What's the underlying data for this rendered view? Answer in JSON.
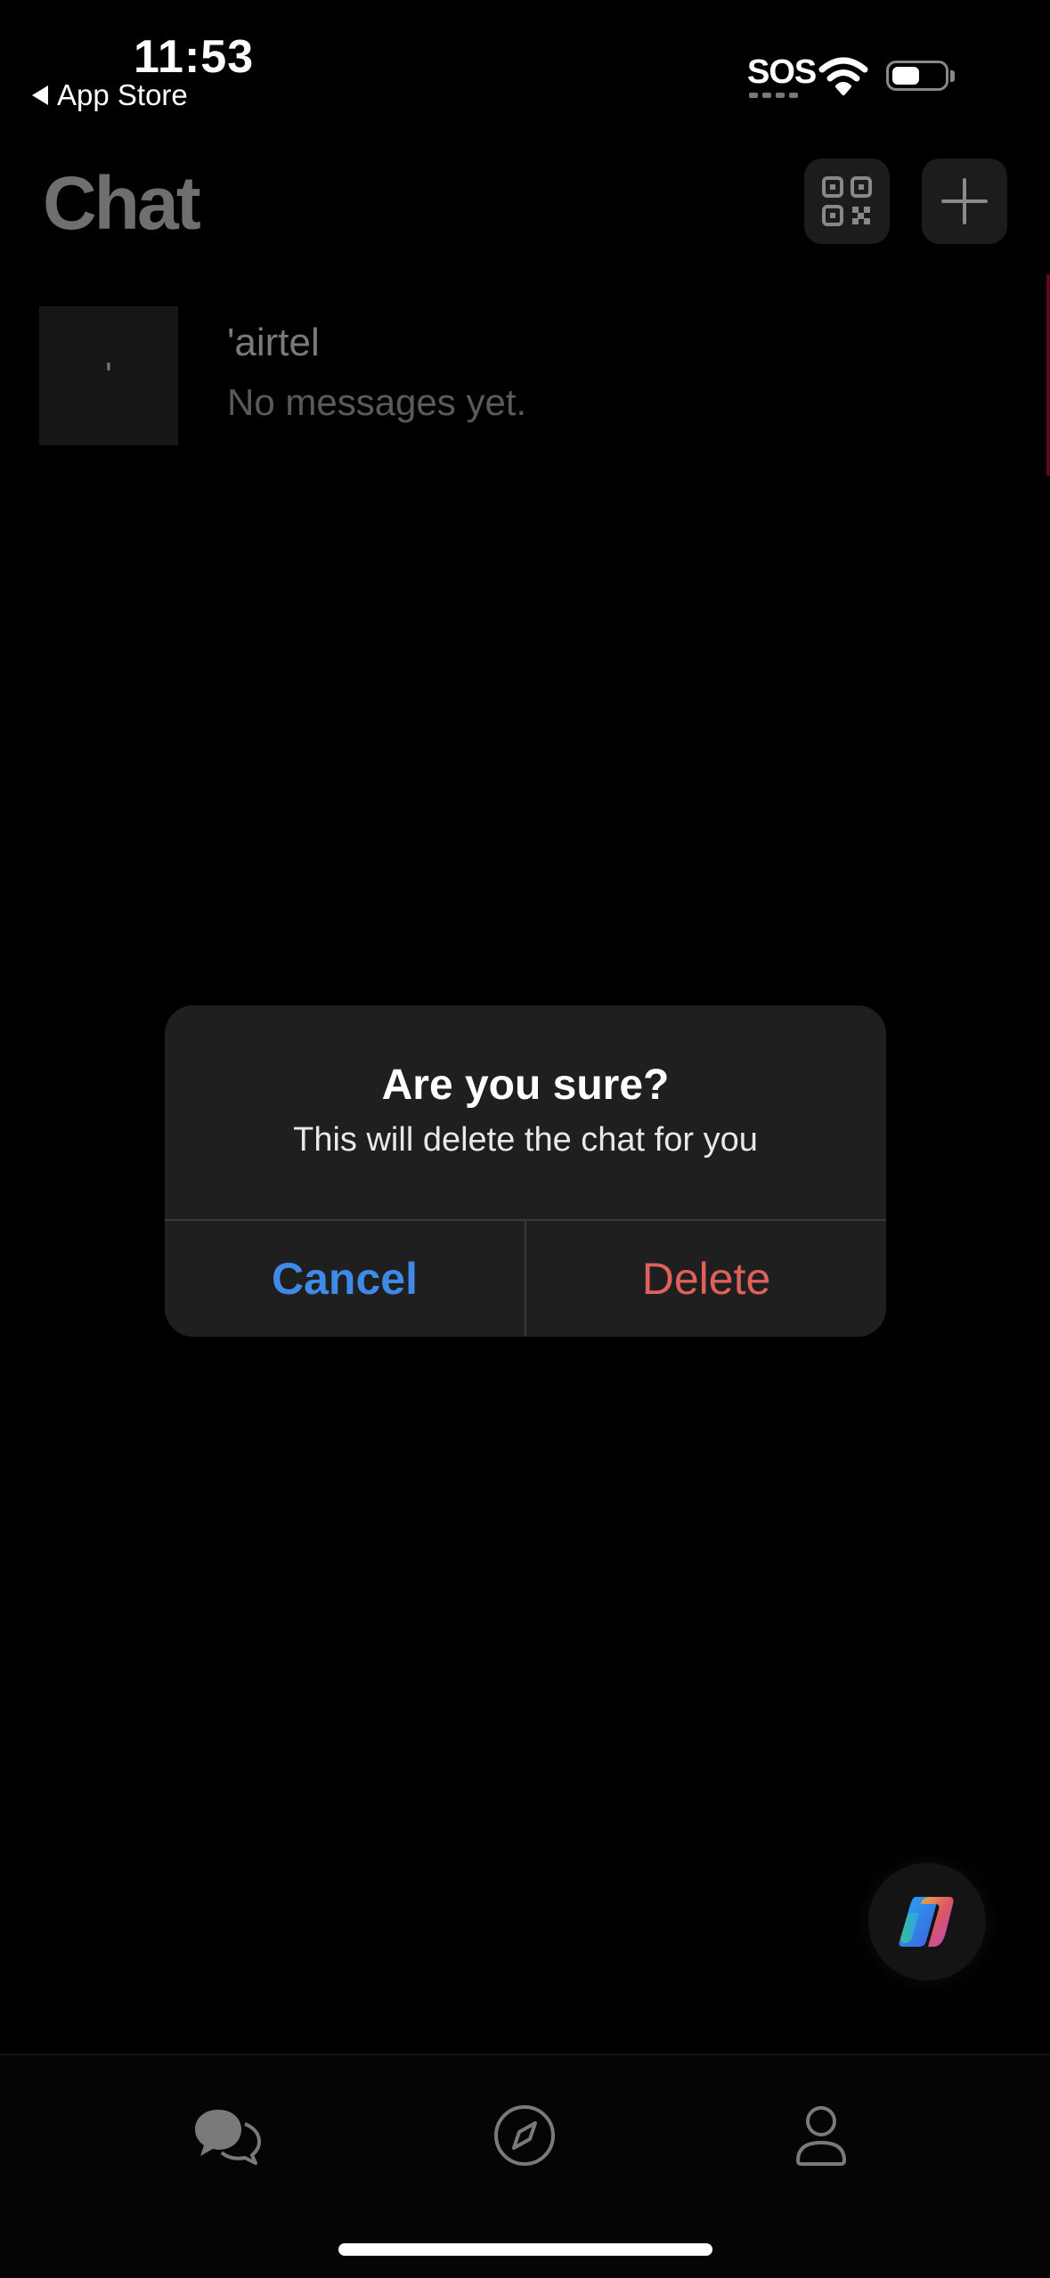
{
  "status_bar": {
    "time": "11:53",
    "back_label": "App Store",
    "sos": "SOS"
  },
  "header": {
    "title": "Chat",
    "qr_icon": "qr-code-icon",
    "add_icon": "plus-icon"
  },
  "chats": [
    {
      "avatar_text": "'",
      "name": "'airtel",
      "preview": "No messages yet."
    }
  ],
  "dialog": {
    "title": "Are you sure?",
    "message": "This will delete the chat for you",
    "cancel_label": "Cancel",
    "delete_label": "Delete"
  },
  "bottom_nav": {
    "items": [
      "chat-icon",
      "compass-icon",
      "profile-icon"
    ]
  },
  "colors": {
    "accent_blue": "#3f8ae6",
    "destructive_red": "#e0605b",
    "dialog_bg": "#1f1f1f"
  }
}
